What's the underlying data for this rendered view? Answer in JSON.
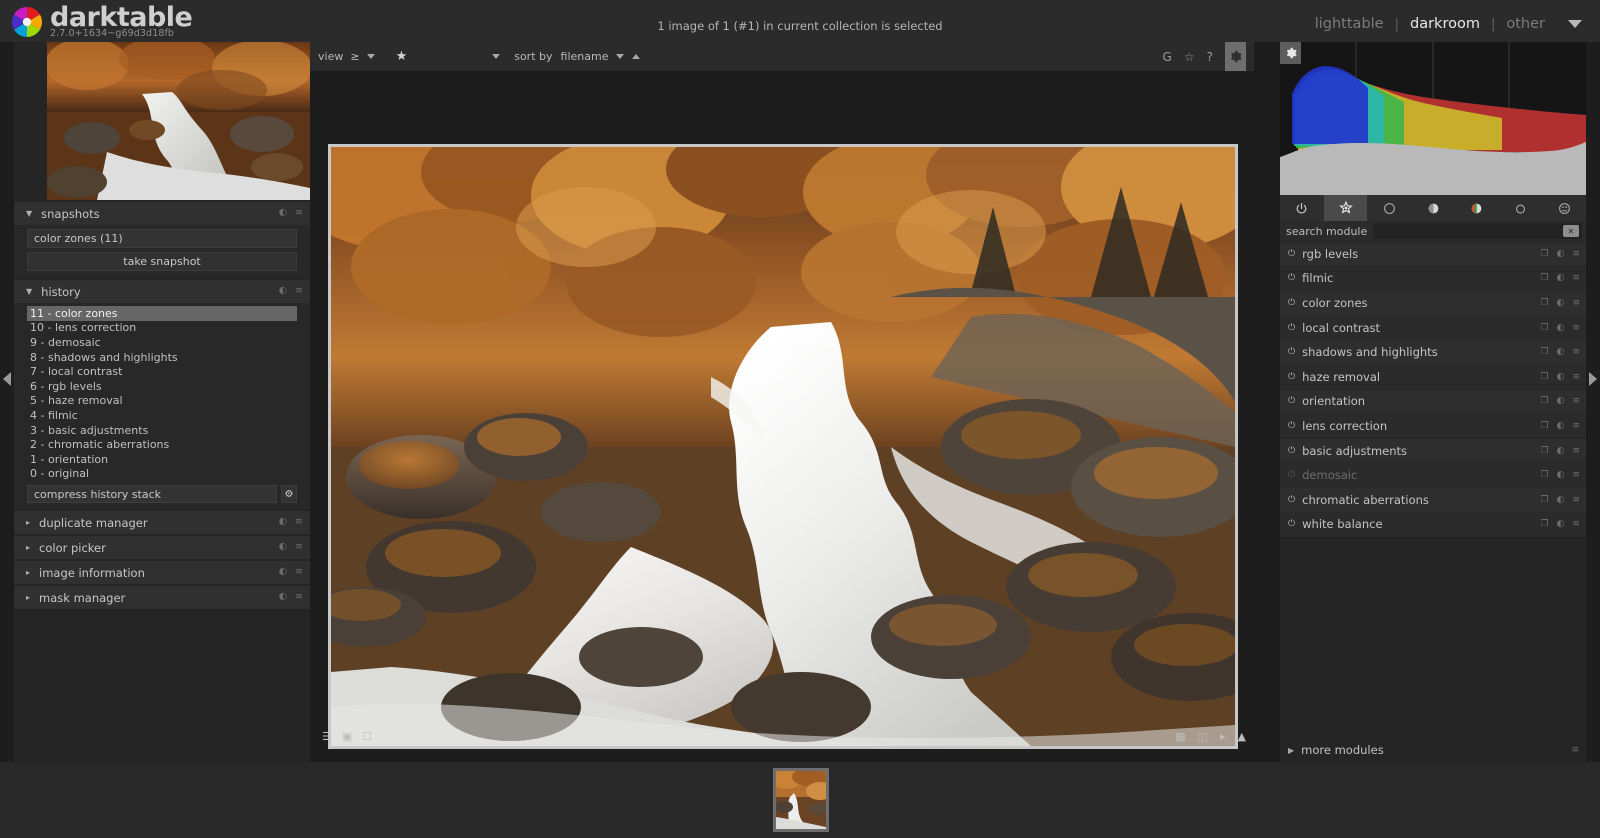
{
  "app": {
    "brand": "darktable",
    "version": "2.7.0+1634~g69d3d18fb",
    "status": "1 image of 1 (#1) in current collection is selected"
  },
  "views": {
    "items": [
      {
        "label": "lighttable",
        "active": false
      },
      {
        "label": "darkroom",
        "active": true
      },
      {
        "label": "other",
        "active": false
      }
    ],
    "separator": "|"
  },
  "left_panel": {
    "navigation": {
      "icons": [
        "fullscreen-icon",
        "chevron-down-icon"
      ]
    },
    "snapshots": {
      "title": "snapshots",
      "entry": "color zones (11)",
      "take_snapshot_label": "take snapshot"
    },
    "history": {
      "title": "history",
      "items": [
        {
          "label": "11 - color zones",
          "selected": true
        },
        {
          "label": "10 - lens correction",
          "selected": false
        },
        {
          "label": "9 - demosaic",
          "selected": false
        },
        {
          "label": "8 - shadows and highlights",
          "selected": false
        },
        {
          "label": "7 - local contrast",
          "selected": false
        },
        {
          "label": "6 - rgb levels",
          "selected": false
        },
        {
          "label": "5 - haze removal",
          "selected": false
        },
        {
          "label": "4 - filmic",
          "selected": false
        },
        {
          "label": "3 - basic adjustments",
          "selected": false
        },
        {
          "label": "2 - chromatic aberrations",
          "selected": false
        },
        {
          "label": "1 - orientation",
          "selected": false
        },
        {
          "label": "0 - original",
          "selected": false
        }
      ],
      "compress_label": "compress history stack"
    },
    "sections": [
      {
        "label": "duplicate manager"
      },
      {
        "label": "color picker"
      },
      {
        "label": "image information"
      },
      {
        "label": "mask manager"
      }
    ]
  },
  "filter_bar": {
    "view_label": "view",
    "comparator": "≥",
    "sort_label": "sort by",
    "sort_value": "filename",
    "right_icons": [
      "G",
      "☆",
      "?"
    ],
    "gear": "gear-icon"
  },
  "bottom_toolbar": {
    "left_icons": [
      "list-icon",
      "mask-icon",
      "display-icon"
    ],
    "right_icons": [
      "histogram-icon",
      "profile-icon",
      "softproof-icon",
      "gamut-icon"
    ]
  },
  "right_panel": {
    "group_tabs": [
      {
        "name": "power-icon",
        "active": false
      },
      {
        "name": "favorites-icon",
        "active": true
      },
      {
        "name": "technical-icon",
        "active": false
      },
      {
        "name": "tone-icon",
        "active": false
      },
      {
        "name": "color-icon",
        "active": false
      },
      {
        "name": "correction-icon",
        "active": false
      },
      {
        "name": "effects-icon",
        "active": false
      }
    ],
    "search": {
      "label": "search module",
      "value": "",
      "clear": "clear-icon"
    },
    "modules": [
      {
        "label": "rgb levels",
        "enabled": true
      },
      {
        "label": "filmic",
        "enabled": true
      },
      {
        "label": "color zones",
        "enabled": true
      },
      {
        "label": "local contrast",
        "enabled": true
      },
      {
        "label": "shadows and highlights",
        "enabled": true
      },
      {
        "label": "haze removal",
        "enabled": true
      },
      {
        "label": "orientation",
        "enabled": true
      },
      {
        "label": "lens correction",
        "enabled": true
      },
      {
        "label": "basic adjustments",
        "enabled": true
      },
      {
        "label": "demosaic",
        "enabled": false
      },
      {
        "label": "chromatic aberrations",
        "enabled": true
      },
      {
        "label": "white balance",
        "enabled": true
      }
    ],
    "more_modules": "more modules"
  },
  "colors": {
    "panel_bg": "#252525",
    "panel_header": "#303030",
    "canvas_bg": "#1d1d1d",
    "topbar_bg": "#2b2b2b",
    "selection": "#666666",
    "accent_text": "#e8e8e8"
  }
}
